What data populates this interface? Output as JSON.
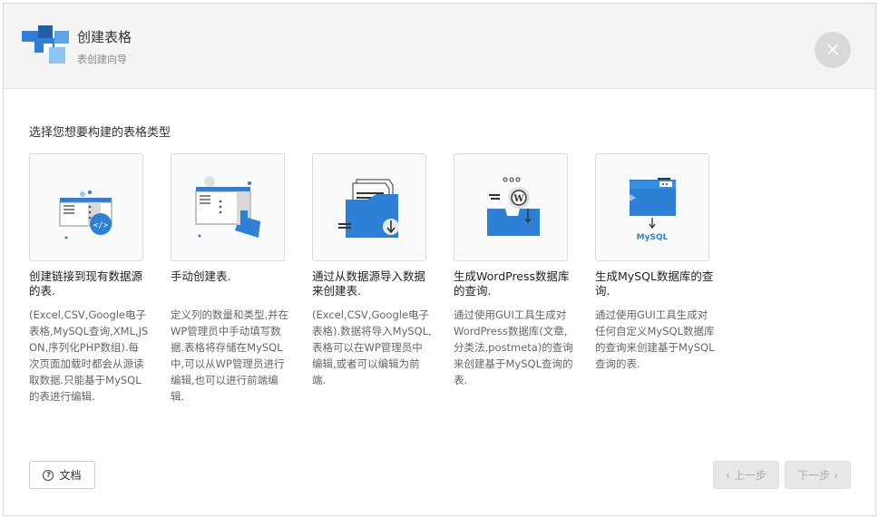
{
  "header": {
    "title": "创建表格",
    "subtitle": "表创建向导",
    "close_symbol": "×"
  },
  "prompt": "选择您想要构建的表格类型",
  "options": [
    {
      "title": "创建链接到现有数据源的表.",
      "description": "(Excel,CSV,Google电子表格,MySQL查询,XML,JSON,序列化PHP数组).每次页面加载时都会从源读取数据.只能基于MySQL的表进行编辑.",
      "icon": "linked-table-icon"
    },
    {
      "title": "手动创建表.",
      "description": "定义列的数量和类型,并在WP管理员中手动填写数据.表格将存储在MySQL中,可以从WP管理员进行编辑,也可以进行前端编辑.",
      "icon": "manual-table-icon"
    },
    {
      "title": "通过从数据源导入数据来创建表.",
      "description": "(Excel,CSV,Google电子表格).数据将导入MySQL,表格可以在WP管理员中编辑,或者可以编辑为前端.",
      "icon": "import-data-icon"
    },
    {
      "title": "生成WordPress数据库的查询.",
      "description": "通过使用GUI工具生成对WordPress数据库(文章,分类法,postmeta)的查询来创建基于MySQL查询的表.",
      "icon": "wordpress-query-icon"
    },
    {
      "title": "生成MySQL数据库的查询.",
      "description": "通过使用GUI工具生成对任何自定义MySQL数据库的查询来创建基于MySQL查询的表.",
      "icon": "mysql-query-icon"
    }
  ],
  "footer": {
    "doc_label": "文档",
    "prev_label": "上一步",
    "next_label": "下一步"
  },
  "colors": {
    "accent": "#2e7fd6",
    "header_bg": "#f4f4f4",
    "close_bg": "#d9d9d9"
  }
}
